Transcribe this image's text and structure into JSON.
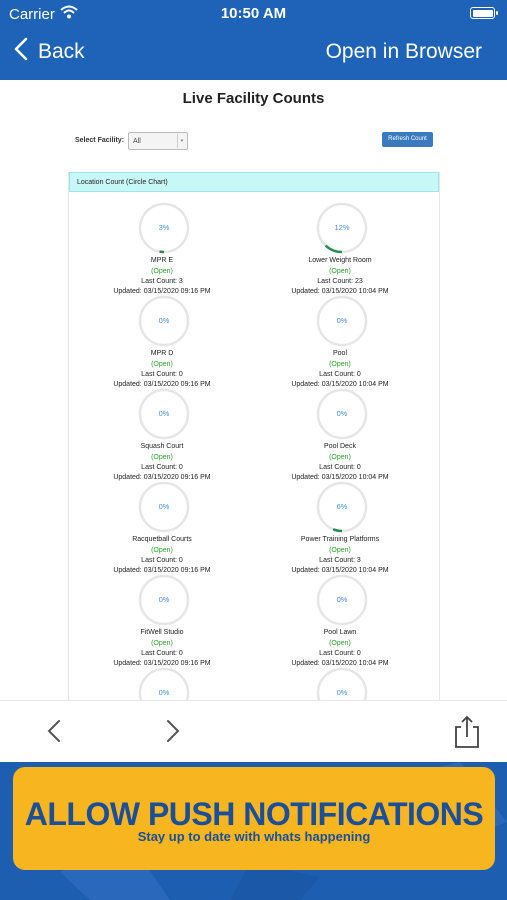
{
  "status_bar": {
    "carrier": "Carrier",
    "time": "10:50 AM"
  },
  "nav": {
    "back_label": "Back",
    "open_browser_label": "Open in Browser"
  },
  "page": {
    "title": "Live Facility Counts",
    "select_label": "Select Facility:",
    "select_value": "All",
    "refresh_label": "Refresh Count",
    "panel_title": "Location Count (Circle Chart)"
  },
  "locations": [
    {
      "pct_text": "3%",
      "pct": 0.03,
      "name": "MPR E",
      "status": "(Open)",
      "count": "Last Count: 3",
      "updated": "Updated: 03/15/2020 09:16 PM"
    },
    {
      "pct_text": "12%",
      "pct": 0.12,
      "name": "Lower Weight Room",
      "status": "(Open)",
      "count": "Last Count: 23",
      "updated": "Updated: 03/15/2020 10:04 PM"
    },
    {
      "pct_text": "0%",
      "pct": 0,
      "name": "MPR D",
      "status": "(Open)",
      "count": "Last Count: 0",
      "updated": "Updated: 03/15/2020 09:16 PM"
    },
    {
      "pct_text": "0%",
      "pct": 0,
      "name": "Pool",
      "status": "(Open)",
      "count": "Last Count: 0",
      "updated": "Updated: 03/15/2020 10:04 PM"
    },
    {
      "pct_text": "0%",
      "pct": 0,
      "name": "Squash Court",
      "status": "(Open)",
      "count": "Last Count: 0",
      "updated": "Updated: 03/15/2020 09:16 PM"
    },
    {
      "pct_text": "0%",
      "pct": 0,
      "name": "Pool Deck",
      "status": "(Open)",
      "count": "Last Count: 0",
      "updated": "Updated: 03/15/2020 10:04 PM"
    },
    {
      "pct_text": "0%",
      "pct": 0,
      "name": "Racquetball Courts",
      "status": "(Open)",
      "count": "Last Count: 0",
      "updated": "Updated: 03/15/2020 09:16 PM"
    },
    {
      "pct_text": "6%",
      "pct": 0.06,
      "name": "Power Training Platforms",
      "status": "(Open)",
      "count": "Last Count: 3",
      "updated": "Updated: 03/15/2020 10:04 PM"
    },
    {
      "pct_text": "0%",
      "pct": 0,
      "name": "FitWell Studio",
      "status": "(Open)",
      "count": "Last Count: 0",
      "updated": "Updated: 03/15/2020 09:16 PM"
    },
    {
      "pct_text": "0%",
      "pct": 0,
      "name": "Pool Lawn",
      "status": "(Open)",
      "count": "Last Count: 0",
      "updated": "Updated: 03/15/2020 10:04 PM"
    },
    {
      "pct_text": "0%",
      "pct": 0
    },
    {
      "pct_text": "0%",
      "pct": 0
    }
  ],
  "toolbar": {
    "back_icon": "chevron-left-icon",
    "forward_icon": "chevron-right-icon",
    "share_icon": "share-icon"
  },
  "push": {
    "title": "ALLOW PUSH NOTIFICATIONS",
    "subtitle": "Stay up to date with whats happening"
  },
  "colors": {
    "nav_bar": "#1e63b8",
    "ring_track": "#e6e6e6",
    "ring_fill": "#2e8b57",
    "percent_text": "#4a8fd6",
    "open_status": "#2e9b2e",
    "push_button": "#f7b51f",
    "push_text": "#1c4f9a"
  }
}
